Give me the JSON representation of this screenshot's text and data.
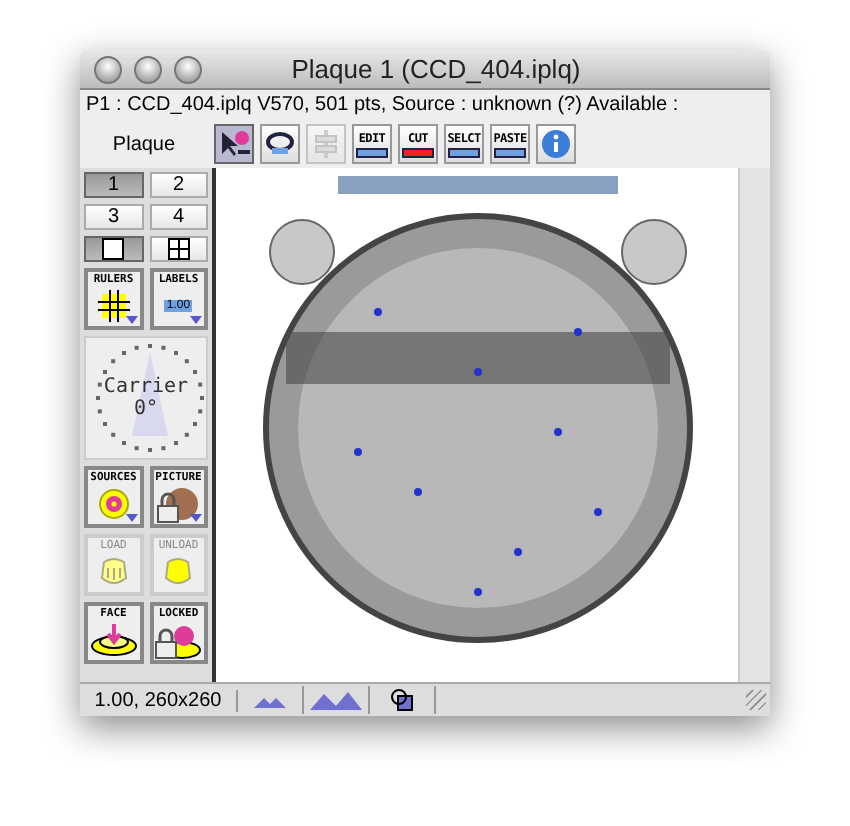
{
  "window": {
    "title": "Plaque 1 (CCD_404.iplq)"
  },
  "info_line": "P1 : CCD_404.iplq V570, 501 pts, Source : unknown (?) Available :",
  "toolbar": {
    "label": "Plaque",
    "buttons": [
      {
        "kind": "pointer",
        "selected": true
      },
      {
        "kind": "rotate",
        "selected": false
      },
      {
        "kind": "align",
        "selected": false,
        "disabled": true
      },
      {
        "kind": "edit",
        "text": "EDIT",
        "selected": false
      },
      {
        "kind": "cut",
        "text": "CUT",
        "selected": false
      },
      {
        "kind": "select",
        "text": "SELCT",
        "selected": false
      },
      {
        "kind": "paste",
        "text": "PASTE",
        "selected": false
      },
      {
        "kind": "info",
        "selected": false
      }
    ]
  },
  "sidebar": {
    "number_buttons": [
      {
        "label": "1",
        "selected": true
      },
      {
        "label": "2",
        "selected": false
      },
      {
        "label": "3",
        "selected": false
      },
      {
        "label": "4",
        "selected": false
      }
    ],
    "view_buttons": [
      {
        "kind": "single",
        "selected": true
      },
      {
        "kind": "grid",
        "selected": false
      }
    ],
    "tools": [
      {
        "kind": "rulers",
        "label": "RULERS",
        "disabled": false
      },
      {
        "kind": "labels",
        "label": "LABELS",
        "value": "1.00",
        "disabled": false
      }
    ],
    "dial": {
      "label": "Carrier",
      "reading": "0°"
    },
    "actions": [
      {
        "kind": "sources",
        "label": "SOURCES",
        "disabled": false
      },
      {
        "kind": "picture",
        "label": "PICTURE",
        "disabled": false
      },
      {
        "kind": "load",
        "label": "LOAD",
        "disabled": true
      },
      {
        "kind": "unload",
        "label": "UNLOAD",
        "disabled": true
      },
      {
        "kind": "face",
        "label": "FACE",
        "disabled": false
      },
      {
        "kind": "locked",
        "label": "LOCKED",
        "disabled": false
      }
    ]
  },
  "status_bar": {
    "text": "1.00, 260x260",
    "buttons": [
      {
        "kind": "zoom-small"
      },
      {
        "kind": "zoom-large"
      },
      {
        "kind": "copy"
      }
    ]
  }
}
